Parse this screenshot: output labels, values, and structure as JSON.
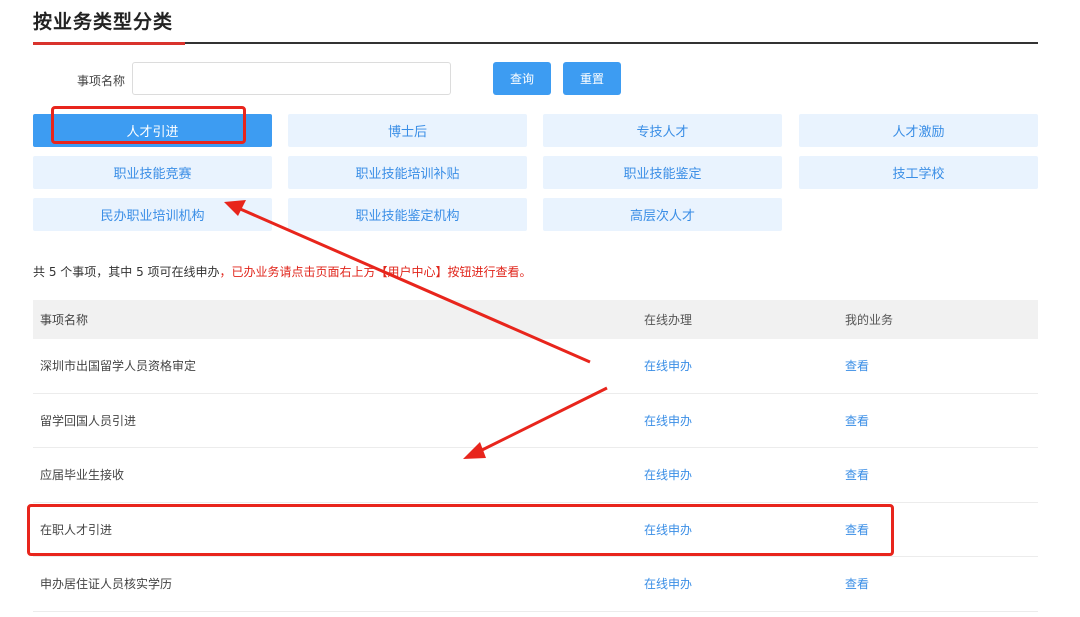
{
  "header": {
    "title": "按业务类型分类"
  },
  "search": {
    "label": "事项名称",
    "value": "",
    "placeholder": "",
    "query_label": "查询",
    "reset_label": "重置"
  },
  "categories": [
    {
      "label": "人才引进",
      "active": true
    },
    {
      "label": "博士后"
    },
    {
      "label": "专技人才"
    },
    {
      "label": "人才激励"
    },
    {
      "label": "职业技能竞赛"
    },
    {
      "label": "职业技能培训补贴"
    },
    {
      "label": "职业技能鉴定"
    },
    {
      "label": "技工学校"
    },
    {
      "label": "民办职业培训机构"
    },
    {
      "label": "职业技能鉴定机构"
    },
    {
      "label": "高层次人才"
    }
  ],
  "summary": {
    "text": "共 5 个事项，其中 5 项可在线申办",
    "notice": "，已办业务请点击页面右上方【用户中心】按钮进行查看。"
  },
  "table": {
    "columns": [
      "事项名称",
      "在线办理",
      "我的业务"
    ],
    "rows": [
      {
        "name": "深圳市出国留学人员资格审定",
        "online": "在线申办",
        "mine": "查看"
      },
      {
        "name": "留学回国人员引进",
        "online": "在线申办",
        "mine": "查看"
      },
      {
        "name": "应届毕业生接收",
        "online": "在线申办",
        "mine": "查看"
      },
      {
        "name": "在职人才引进",
        "online": "在线申办",
        "mine": "查看"
      },
      {
        "name": "申办居住证人员核实学历",
        "online": "在线申办",
        "mine": "查看"
      }
    ]
  },
  "colors": {
    "accent": "#3d9cf2",
    "category_bg": "#e9f3fe",
    "annotation": "#e8251c"
  }
}
